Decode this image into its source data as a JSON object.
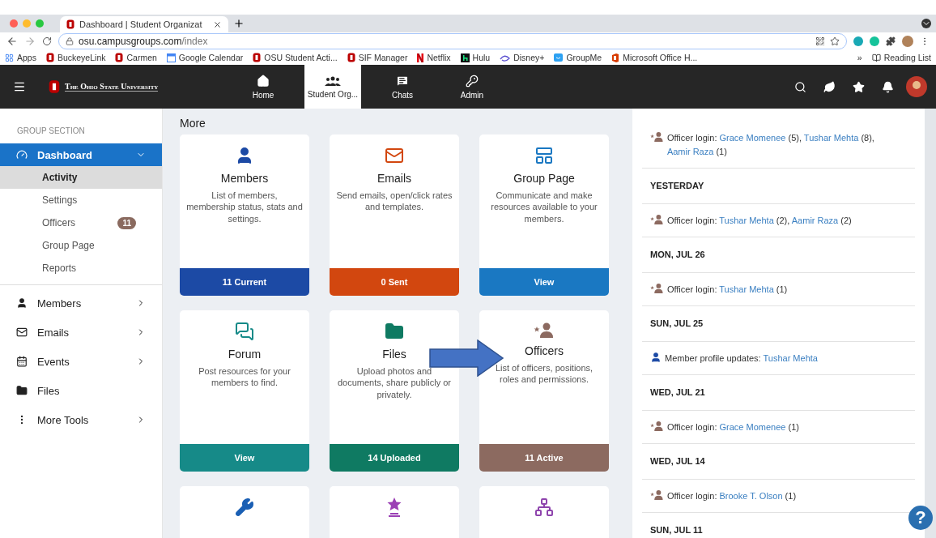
{
  "browser": {
    "tab": {
      "title": "Dashboard | Student Organizat",
      "selected": true
    },
    "url": {
      "host": "osu.campusgroups.com",
      "path": "/index"
    },
    "bookmarks": [
      {
        "label": "Apps",
        "kind": "apps"
      },
      {
        "label": "BuckeyeLink",
        "kind": "osu"
      },
      {
        "label": "Carmen",
        "kind": "osu"
      },
      {
        "label": "Google Calendar",
        "kind": "calendar"
      },
      {
        "label": "OSU Student Acti...",
        "kind": "osu"
      },
      {
        "label": "SIF Manager",
        "kind": "osu"
      },
      {
        "label": "Netflix",
        "kind": "netflix"
      },
      {
        "label": "Hulu",
        "kind": "hulu"
      },
      {
        "label": "Disney+",
        "kind": "disney"
      },
      {
        "label": "GroupMe",
        "kind": "groupme"
      },
      {
        "label": "Microsoft Office H...",
        "kind": "office"
      }
    ],
    "more_bookmarks": "»",
    "reading_list": "Reading List"
  },
  "header": {
    "logo": "The Ohio State University",
    "nav": [
      {
        "label": "Home",
        "kind": "home",
        "selected": false
      },
      {
        "label": "Student Org...",
        "kind": "groups",
        "selected": true
      },
      {
        "label": "Chats",
        "kind": "chats",
        "selected": false
      },
      {
        "label": "Admin",
        "kind": "admin",
        "selected": false
      }
    ]
  },
  "sidebar": {
    "section": "GROUP SECTION",
    "items": [
      {
        "label": "Dashboard",
        "kind": "dashboard",
        "selected": true,
        "expanded": true,
        "children": [
          {
            "label": "Activity",
            "selected": true
          },
          {
            "label": "Settings",
            "selected": false
          },
          {
            "label": "Officers",
            "selected": false,
            "badge": "11"
          },
          {
            "label": "Group Page",
            "selected": false
          },
          {
            "label": "Reports",
            "selected": false
          }
        ]
      },
      {
        "label": "Members",
        "kind": "members",
        "selected": false,
        "expanded": false
      },
      {
        "label": "Emails",
        "kind": "emails",
        "selected": false,
        "expanded": false
      },
      {
        "label": "Events",
        "kind": "events",
        "selected": false,
        "expanded": false
      },
      {
        "label": "Files",
        "kind": "files",
        "selected": false
      },
      {
        "label": "More Tools",
        "kind": "tools",
        "selected": false,
        "expanded": false
      }
    ]
  },
  "main": {
    "heading": "More",
    "cards": [
      {
        "kind": "members",
        "title": "Members",
        "description": "List of members, membership status, stats and settings.",
        "footer": "11 Current",
        "color": "#1c4aa5"
      },
      {
        "kind": "emails",
        "title": "Emails",
        "description": "Send emails, open/click rates and templates.",
        "footer": "0 Sent",
        "color": "#d2470f"
      },
      {
        "kind": "page",
        "title": "Group Page",
        "description": "Communicate and make resources available to your members.",
        "footer": "View",
        "color": "#1a78c2"
      },
      {
        "kind": "forum",
        "title": "Forum",
        "description": "Post resources for your members to find.",
        "footer": "View",
        "color": "#168a88"
      },
      {
        "kind": "files",
        "title": "Files",
        "description": "Upload photos and documents, share publicly or privately.",
        "footer": "14 Uploaded",
        "color": "#0f7a62"
      },
      {
        "kind": "officers",
        "title": "Officers",
        "description": "List of officers, positions, roles and permissions.",
        "footer": "11 Active",
        "color": "#8c6a60"
      },
      {
        "kind": "tools",
        "color": "#1a5fb4"
      },
      {
        "kind": "awards",
        "color": "#9b3fb5"
      },
      {
        "kind": "graph",
        "color": "#8e44ad"
      }
    ]
  },
  "activity": [
    {
      "kind": "officer",
      "parts": [
        {
          "text": "Officer login: "
        },
        {
          "text": "Grace Momenee",
          "link": true
        },
        {
          "text": " (5), "
        },
        {
          "text": "Tushar Mehta",
          "link": true
        },
        {
          "text": " (8), "
        },
        {
          "text": "Aamir Raza",
          "link": true
        },
        {
          "text": " (1)"
        }
      ]
    },
    {
      "kind": "date",
      "text": "YESTERDAY"
    },
    {
      "kind": "officer",
      "parts": [
        {
          "text": "Officer login: "
        },
        {
          "text": "Tushar Mehta",
          "link": true
        },
        {
          "text": " (2), "
        },
        {
          "text": "Aamir Raza",
          "link": true
        },
        {
          "text": " (2)"
        }
      ]
    },
    {
      "kind": "date",
      "text": "MON, JUL 26"
    },
    {
      "kind": "officer",
      "parts": [
        {
          "text": "Officer login: "
        },
        {
          "text": "Tushar Mehta",
          "link": true
        },
        {
          "text": " (1)"
        }
      ]
    },
    {
      "kind": "date",
      "text": "SUN, JUL 25"
    },
    {
      "kind": "member",
      "parts": [
        {
          "text": "Member profile updates: "
        },
        {
          "text": "Tushar Mehta",
          "link": true
        }
      ]
    },
    {
      "kind": "date",
      "text": "WED, JUL 21"
    },
    {
      "kind": "officer",
      "parts": [
        {
          "text": "Officer login: "
        },
        {
          "text": "Grace Momenee",
          "link": true
        },
        {
          "text": " (1)"
        }
      ]
    },
    {
      "kind": "date",
      "text": "WED, JUL 14"
    },
    {
      "kind": "officer",
      "parts": [
        {
          "text": "Officer login: "
        },
        {
          "text": "Brooke T. Olson",
          "link": true
        },
        {
          "text": " (1)"
        }
      ]
    },
    {
      "kind": "date",
      "text": "SUN, JUL 11"
    }
  ],
  "help_button": "?"
}
